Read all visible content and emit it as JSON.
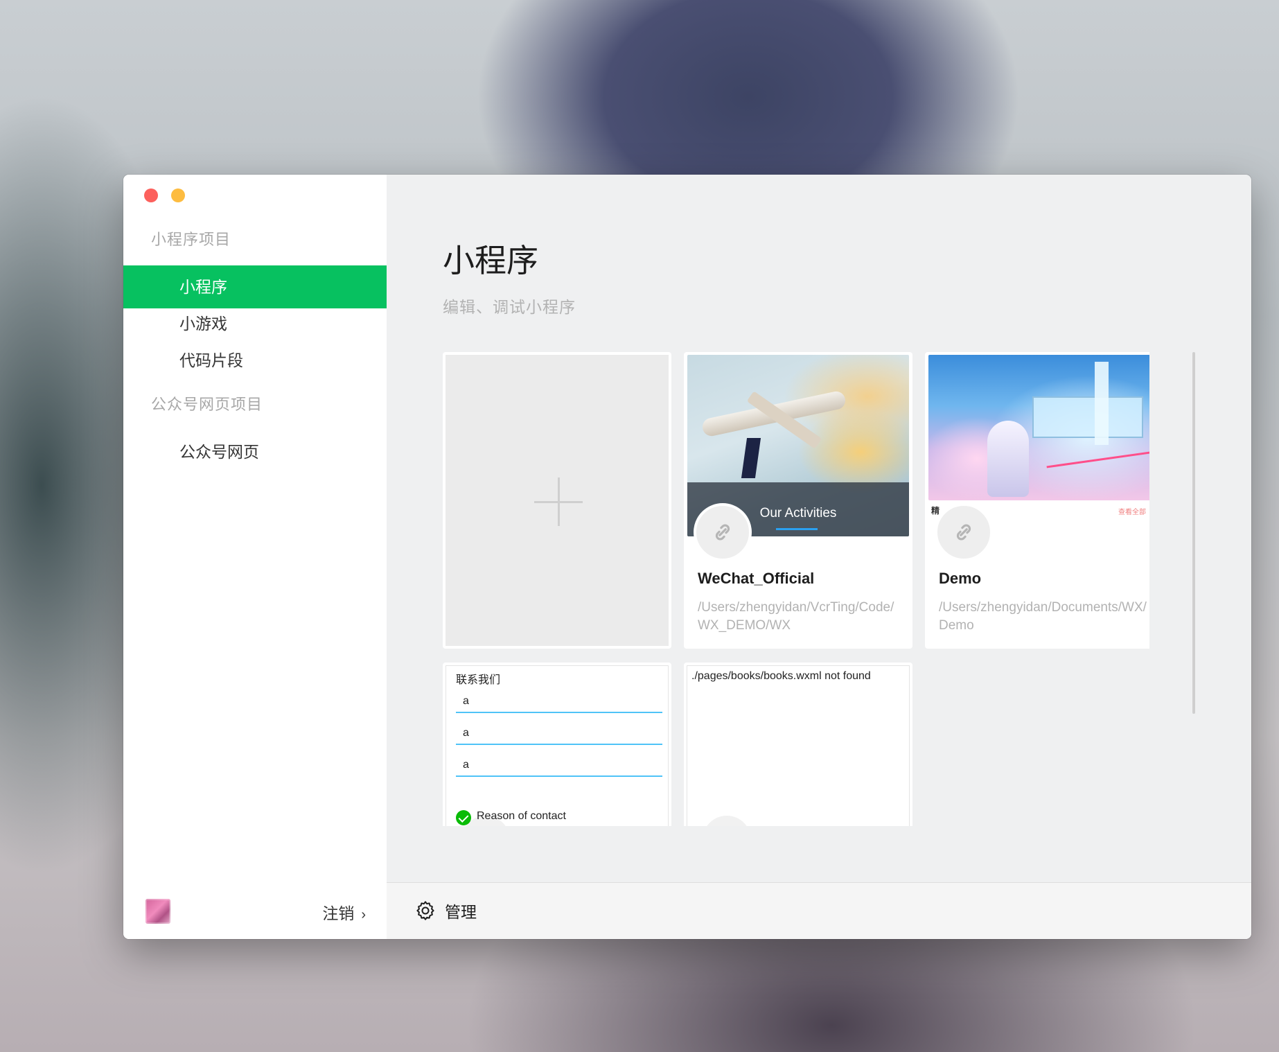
{
  "window": {
    "traffic": [
      "close",
      "minimize"
    ]
  },
  "sidebar": {
    "group1_label": "小程序项目",
    "items": [
      {
        "label": "小程序",
        "active": true
      },
      {
        "label": "小游戏",
        "active": false
      },
      {
        "label": "代码片段",
        "active": false
      }
    ],
    "group2_label": "公众号网页项目",
    "items2": [
      {
        "label": "公众号网页",
        "active": false
      }
    ],
    "logout_label": "注销",
    "logout_chevron": "›"
  },
  "main": {
    "title": "小程序",
    "subtitle": "编辑、调试小程序",
    "projects": [
      {
        "name": "WeChat_Official",
        "path": "/Users/zhengyidan/VcrTing/Code/WX_DEMO/WX",
        "thumb_caption": "Our Activities"
      },
      {
        "name": "Demo",
        "path": "/Users/zhengyidan/Documents/WX/Demo",
        "thumb_caption": "查看全部"
      }
    ],
    "contact_card": {
      "title": "联系我们",
      "fields": [
        "a",
        "a",
        "a"
      ],
      "reason": "Reason of contact"
    },
    "error_card": {
      "message": "./pages/books/books.wxml not found"
    }
  },
  "bottom_bar": {
    "manage_label": "管理"
  },
  "colors": {
    "accent": "#07c160",
    "window_bg": "#eff0f1"
  },
  "icons": [
    "gear-icon",
    "plus-icon",
    "link-icon",
    "chevron-right-icon",
    "check-icon"
  ]
}
